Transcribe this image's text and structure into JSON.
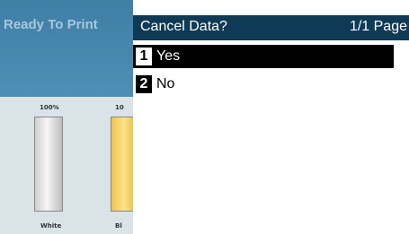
{
  "background_screen": {
    "status": "Ready To Print",
    "gauges": [
      {
        "percent_label": "100%",
        "name": "White",
        "level": 1.0,
        "color": "#e6e6e6"
      },
      {
        "percent_label": "10",
        "name": "Bl",
        "level": 1.0,
        "color": "#f6cf5a"
      }
    ]
  },
  "dialog": {
    "title": "Cancel Data?",
    "page_indicator": "1/1 Page",
    "options": [
      {
        "number": "1",
        "label": "Yes",
        "selected": true
      },
      {
        "number": "2",
        "label": "No",
        "selected": false
      }
    ]
  },
  "colors": {
    "title_bar": "#0f3a55",
    "selection": "#000000",
    "left_header": "#4e8fb6"
  }
}
